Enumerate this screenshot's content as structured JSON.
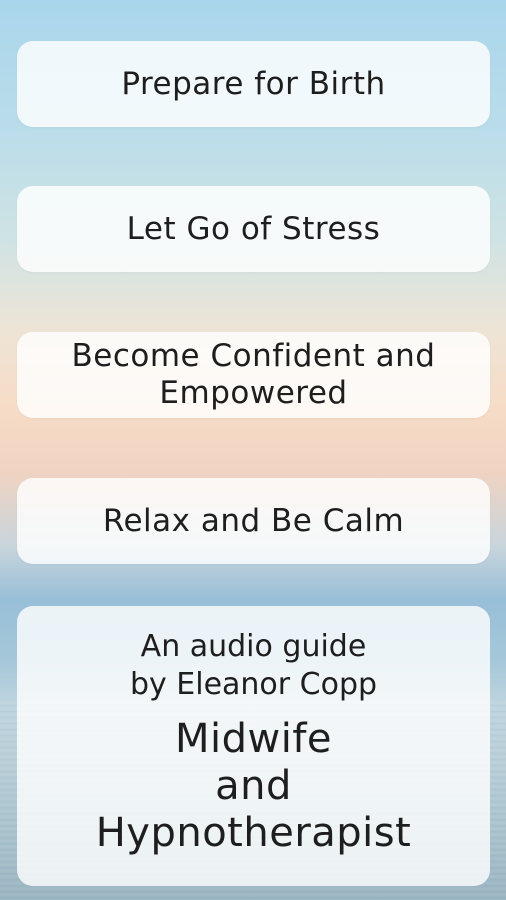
{
  "menu": {
    "buttons": [
      {
        "label": "Prepare for Birth"
      },
      {
        "label": "Let Go of Stress"
      },
      {
        "label_line1": "Become Confident and",
        "label_line2": "Empowered"
      },
      {
        "label": "Relax and Be Calm"
      }
    ]
  },
  "info": {
    "guide_line1": "An audio guide",
    "guide_line2": "by Eleanor Copp",
    "title_line1": "Midwife",
    "title_line2": "and",
    "title_line3": "Hypnotherapist"
  }
}
